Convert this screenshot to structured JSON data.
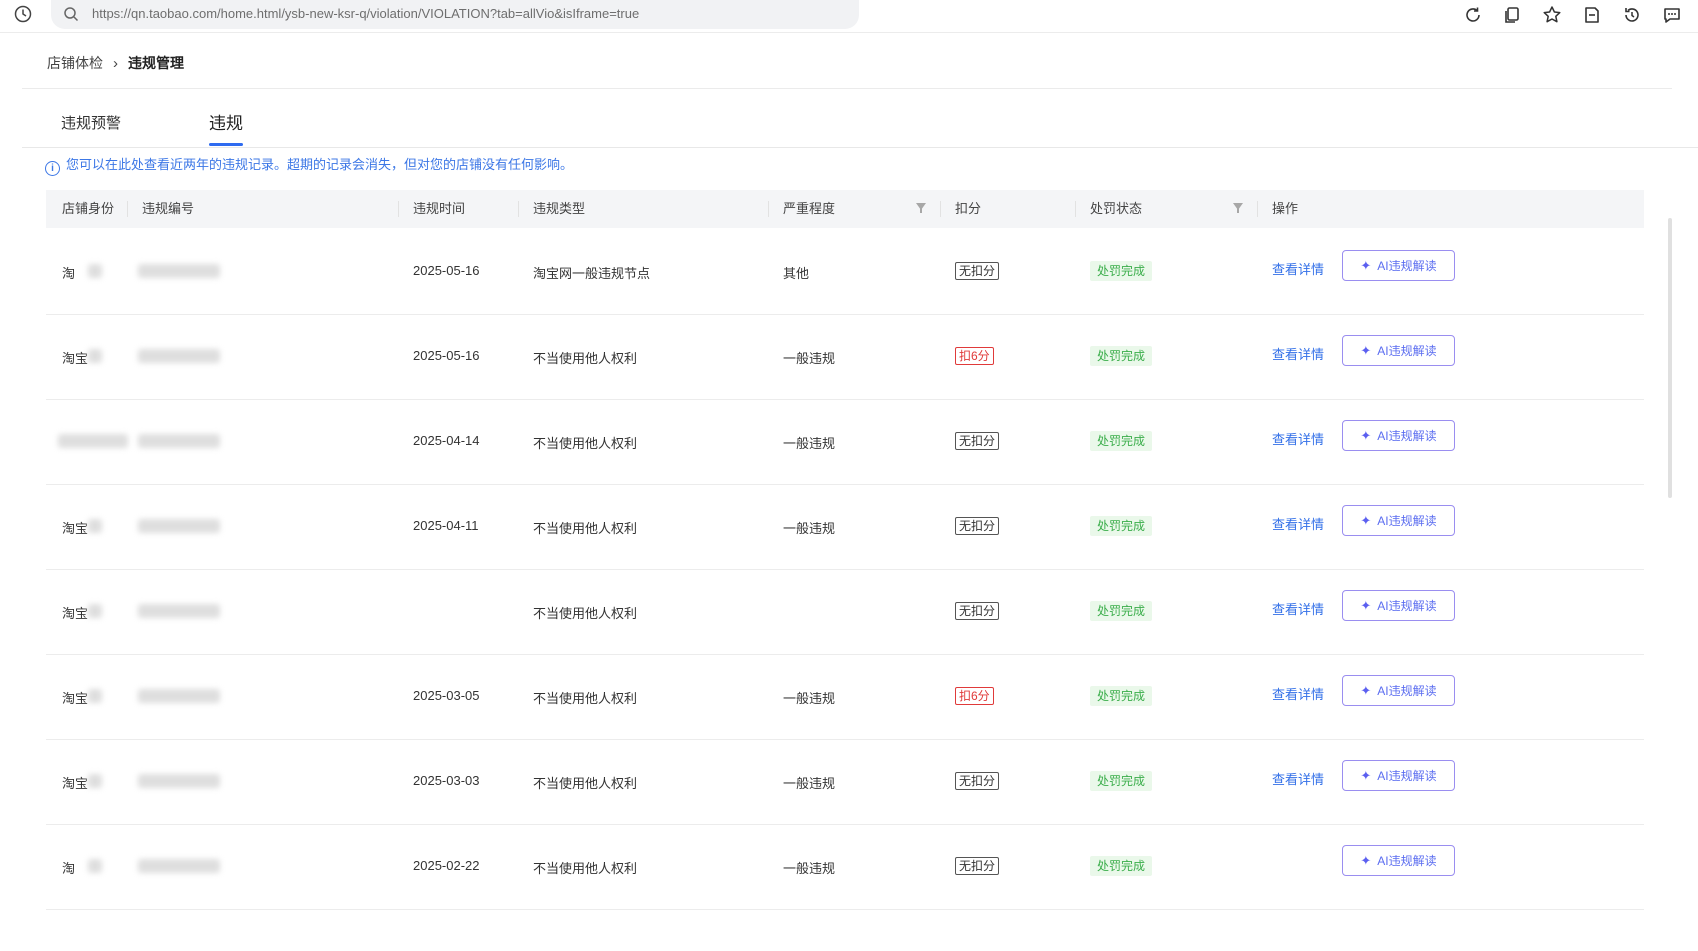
{
  "browser": {
    "url": "https://qn.taobao.com/home.html/ysb-new-ksr-q/violation/VIOLATION?tab=allVio&isIframe=true",
    "toolbar_icons": [
      "refresh-icon",
      "copy-icon",
      "star-icon",
      "bookmark-icon",
      "history-arrow-icon",
      "chat-icon"
    ]
  },
  "breadcrumb": {
    "parent": "店铺体检",
    "separator": "›",
    "current": "违规管理"
  },
  "tabs": [
    {
      "label": "违规预警"
    },
    {
      "label": "违规",
      "active": true
    }
  ],
  "notice": "您可以在此处查看近两年的违规记录。超期的记录会消失，但对您的店铺没有任何影响。",
  "table": {
    "headers": {
      "identity": "店铺身份",
      "number": "违规编号",
      "time": "违规时间",
      "type": "违规类型",
      "severity": "严重程度",
      "points": "扣分",
      "status": "处罚状态",
      "action": "操作"
    },
    "rows": [
      {
        "identity": "淘",
        "date": "2025-05-16",
        "type": "淘宝网一般违规节点",
        "severity": "其他",
        "points": "无扣分",
        "points_red": false,
        "status": "处罚完成",
        "detail": "查看详情",
        "ai": "AI违规解读"
      },
      {
        "identity": "淘宝",
        "date": "2025-05-16",
        "type": "不当使用他人权利",
        "severity": "一般违规",
        "points": "扣6分",
        "points_red": true,
        "status": "处罚完成",
        "detail": "查看详情",
        "ai": "AI违规解读"
      },
      {
        "identity": "",
        "date": "2025-04-14",
        "type": "不当使用他人权利",
        "severity": "一般违规",
        "points": "无扣分",
        "points_red": false,
        "status": "处罚完成",
        "detail": "查看详情",
        "ai": "AI违规解读"
      },
      {
        "identity": "淘宝",
        "date": "2025-04-11",
        "type": "不当使用他人权利",
        "severity": "一般违规",
        "points": "无扣分",
        "points_red": false,
        "status": "处罚完成",
        "detail": "查看详情",
        "ai": "AI违规解读"
      },
      {
        "identity": "淘宝",
        "date": "",
        "type": "不当使用他人权利",
        "severity": "",
        "points": "无扣分",
        "points_red": false,
        "status": "处罚完成",
        "detail": "查看详情",
        "ai": "AI违规解读"
      },
      {
        "identity": "淘宝",
        "date": "2025-03-05",
        "type": "不当使用他人权利",
        "severity": "一般违规",
        "points": "扣6分",
        "points_red": true,
        "status": "处罚完成",
        "detail": "查看详情",
        "ai": "AI违规解读"
      },
      {
        "identity": "淘宝",
        "date": "2025-03-03",
        "type": "不当使用他人权利",
        "severity": "一般违规",
        "points": "无扣分",
        "points_red": false,
        "status": "处罚完成",
        "detail": "查看详情",
        "ai": "AI违规解读"
      },
      {
        "identity": "淘",
        "date": "2025-02-22",
        "type": "不当使用他人权利",
        "severity": "一般违规",
        "points": "无扣分",
        "points_red": false,
        "status": "处罚完成",
        "detail": "",
        "ai": "AI违规解读"
      }
    ]
  },
  "colors": {
    "accent": "#2e6bf0",
    "status_green": "#3bae4b",
    "penalty_red": "#e03a3a",
    "ai_purple": "#9a8ef0"
  }
}
